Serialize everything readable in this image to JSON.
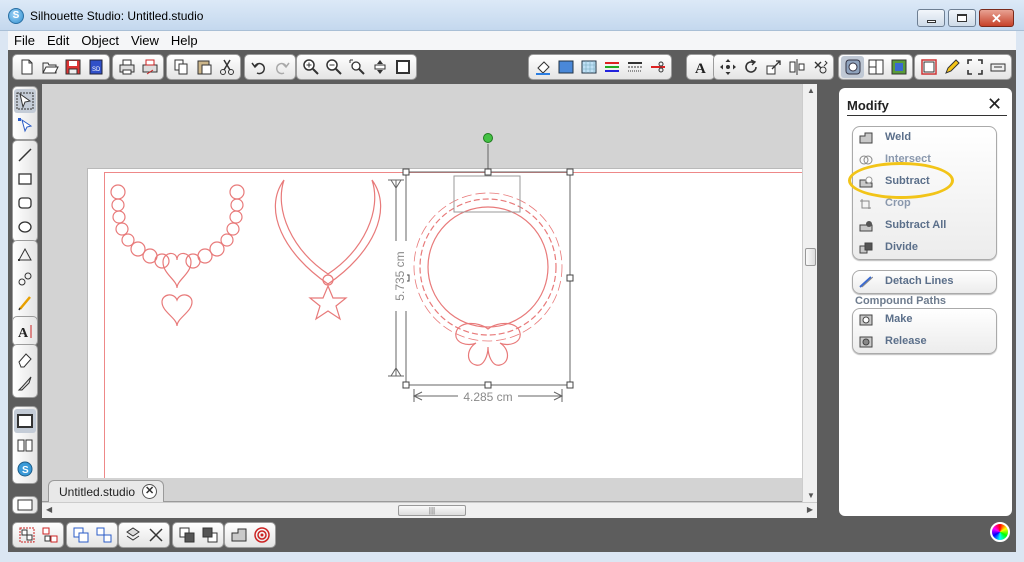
{
  "window": {
    "title": "Silhouette Studio: Untitled.studio",
    "app_icon_letter": "S"
  },
  "menu": {
    "items": [
      "File",
      "Edit",
      "Object",
      "View",
      "Help"
    ]
  },
  "toolbar": {
    "groups": [
      [
        "new-document-icon",
        "open-icon",
        "save-icon",
        "save-to-library-icon"
      ],
      [
        "print-icon",
        "print-cut-icon"
      ],
      [
        "copy-icon",
        "paste-icon",
        "cut-icon"
      ],
      [
        "undo-icon",
        "redo-icon"
      ],
      [
        "zoom-in-icon",
        "zoom-out-icon",
        "zoom-select-icon",
        "pan-icon",
        "fit-page-icon"
      ],
      [
        "fill-color-icon",
        "fill-gradient-icon",
        "fill-pattern-icon",
        "line-color-icon",
        "line-style-icon",
        "cut-style-icon"
      ],
      [
        "text-style-icon"
      ],
      [
        "move-icon",
        "rotate-icon",
        "scale-icon",
        "align-icon",
        "replicate-icon"
      ],
      [
        "modify-icon",
        "offset-icon",
        "trace-icon"
      ],
      [
        "page-setup-icon",
        "sketch-icon",
        "fullscreen-icon",
        "send-to-cutter-icon"
      ]
    ]
  },
  "left_tools": [
    [
      "select-tool-icon",
      "point-edit-tool-icon"
    ],
    [
      "line-tool-icon",
      "rectangle-tool-icon",
      "rounded-rectangle-tool-icon",
      "ellipse-tool-icon"
    ],
    [
      "polygon-tool-icon",
      "curve-tool-icon",
      "freehand-tool-icon",
      "smooth-freehand-tool-icon"
    ],
    [
      "text-tool-icon"
    ],
    [
      "eraser-tool-icon",
      "knife-tool-icon"
    ],
    [
      "registration-marks-icon",
      "library-icon",
      "silhouette-store-icon"
    ]
  ],
  "canvas": {
    "height_dimension": "5.735 cm",
    "width_dimension": "4.285 cm",
    "cut_line_color": "#e88080",
    "selection_color": "#555555"
  },
  "document_tab": {
    "label": "Untitled.studio",
    "close_symbol": "✕"
  },
  "modify_panel": {
    "title": "Modify",
    "close_symbol": "✕",
    "group1": [
      {
        "label": "Weld",
        "icon": "weld-icon"
      },
      {
        "label": "Intersect",
        "icon": "intersect-icon"
      },
      {
        "label": "Subtract",
        "icon": "subtract-icon"
      },
      {
        "label": "Crop",
        "icon": "crop-icon"
      },
      {
        "label": "Subtract All",
        "icon": "subtract-all-icon"
      },
      {
        "label": "Divide",
        "icon": "divide-icon"
      }
    ],
    "detach_lines": {
      "label": "Detach Lines",
      "icon": "detach-lines-icon"
    },
    "compound_paths_label": "Compound Paths",
    "compound": [
      {
        "label": "Make",
        "icon": "make-compound-icon"
      },
      {
        "label": "Release",
        "icon": "release-compound-icon"
      }
    ],
    "highlight_color": "#f2c418"
  },
  "bottom_toolbar": {
    "groups": [
      [
        "group-icon",
        "ungroup-icon"
      ],
      [
        "make-compound-path-icon",
        "release-compound-path-icon"
      ],
      [
        "bring-forward-icon",
        "delete-icon"
      ],
      [
        "bring-to-front-icon",
        "send-to-back-icon"
      ],
      [
        "weld-shape-icon",
        "offset-target-icon"
      ]
    ],
    "color_wheel": "color-wheel-icon"
  }
}
